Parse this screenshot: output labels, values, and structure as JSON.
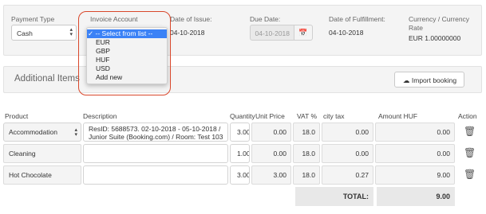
{
  "header": {
    "payment_type": {
      "label": "Payment Type",
      "value": "Cash"
    },
    "invoice_account": {
      "label": "Invoice Account"
    },
    "date_of_issue": {
      "label": "Date of Issue:",
      "value": "04-10-2018"
    },
    "due_date": {
      "label": "Due Date:",
      "value": "04-10-2018"
    },
    "date_of_fulfillment": {
      "label": "Date of Fulfillment:",
      "value": "04-10-2018"
    },
    "currency": {
      "label_line1": "Currency / Currency",
      "label_line2": "Rate",
      "value": "EUR 1.00000000"
    }
  },
  "account_dropdown": {
    "options": [
      {
        "label": "-- Select from list --",
        "selected": true,
        "check": "✓"
      },
      {
        "label": "EUR",
        "selected": false
      },
      {
        "label": "GBP",
        "selected": false
      },
      {
        "label": "HUF",
        "selected": false
      },
      {
        "label": "USD",
        "selected": false
      },
      {
        "label": "Add new",
        "selected": false
      }
    ]
  },
  "additional_items": {
    "title": "Additional Items",
    "import_button": "Import booking",
    "icon": "cloud-upload-icon"
  },
  "table": {
    "headers": {
      "product": "Product",
      "description": "Description",
      "quantity": "Quantity",
      "unit_price": "Unit Price",
      "vat": "VAT %",
      "city_tax": "city tax",
      "amount": "Amount HUF",
      "action": "Action"
    },
    "rows": [
      {
        "product": "Accommodation",
        "product_is_select": true,
        "description_line1": "ResID: 5688573. 02-10-2018 - 05-10-2018 /",
        "description_line2": "Junior Suite (Booking.com) / Room: Test 103",
        "quantity": "3.00",
        "unit_price": "0.00",
        "vat": "18.0",
        "city_tax": "0.00",
        "amount": "0.00"
      },
      {
        "product": "Cleaning",
        "product_is_select": false,
        "description_line1": "",
        "description_line2": "",
        "quantity": "1.00",
        "unit_price": "0.00",
        "vat": "18.0",
        "city_tax": "0.00",
        "amount": "0.00"
      },
      {
        "product": "Hot Chocolate",
        "product_is_select": false,
        "description_line1": "",
        "description_line2": "",
        "quantity": "3.00",
        "unit_price": "3.00",
        "vat": "18.0",
        "city_tax": "0.27",
        "amount": "9.00"
      }
    ],
    "total_label": "TOTAL:",
    "total_value": "9.00"
  },
  "colors": {
    "accent": "#3b82f6",
    "callout": "#d9472b",
    "panel": "#f4f4f4"
  }
}
